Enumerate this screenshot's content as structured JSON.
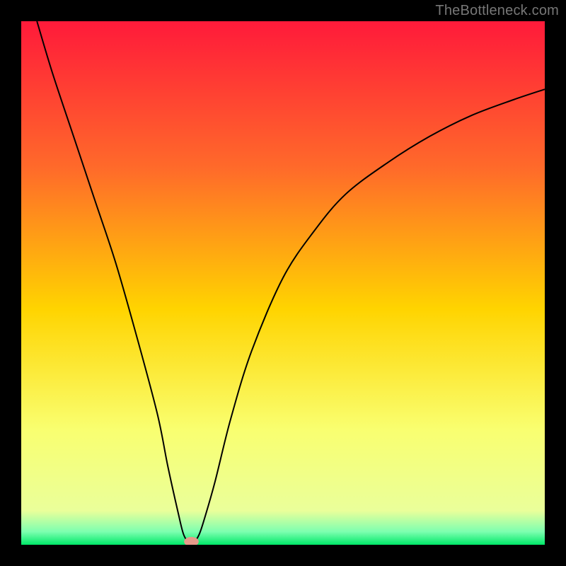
{
  "watermark": "TheBottleneck.com",
  "chart_data": {
    "type": "line",
    "title": "",
    "xlabel": "",
    "ylabel": "",
    "xlim": [
      0,
      100
    ],
    "ylim": [
      0,
      100
    ],
    "background_gradient": {
      "stops": [
        {
          "offset": 0.0,
          "color": "#ff1a3a"
        },
        {
          "offset": 0.28,
          "color": "#ff6a2a"
        },
        {
          "offset": 0.55,
          "color": "#ffd400"
        },
        {
          "offset": 0.78,
          "color": "#f9ff70"
        },
        {
          "offset": 0.935,
          "color": "#eaff9a"
        },
        {
          "offset": 0.975,
          "color": "#7dffb0"
        },
        {
          "offset": 1.0,
          "color": "#00e868"
        }
      ]
    },
    "series": [
      {
        "name": "bottleneck-curve",
        "color": "#000000",
        "x": [
          3,
          6,
          10,
          14,
          18,
          22,
          26,
          28,
          30,
          31,
          32,
          33,
          34,
          35,
          37,
          40,
          44,
          50,
          56,
          62,
          70,
          78,
          86,
          94,
          100
        ],
        "y": [
          100,
          90,
          78,
          66,
          54,
          40,
          25,
          15,
          6,
          2,
          0.5,
          0.5,
          2,
          5,
          12,
          24,
          37,
          51,
          60,
          67,
          73,
          78,
          82,
          85,
          87
        ]
      }
    ],
    "marker": {
      "name": "optimal-point",
      "x": 32.5,
      "y": 0.6,
      "rx": 1.4,
      "ry": 0.9,
      "color": "#e69a8a"
    }
  }
}
